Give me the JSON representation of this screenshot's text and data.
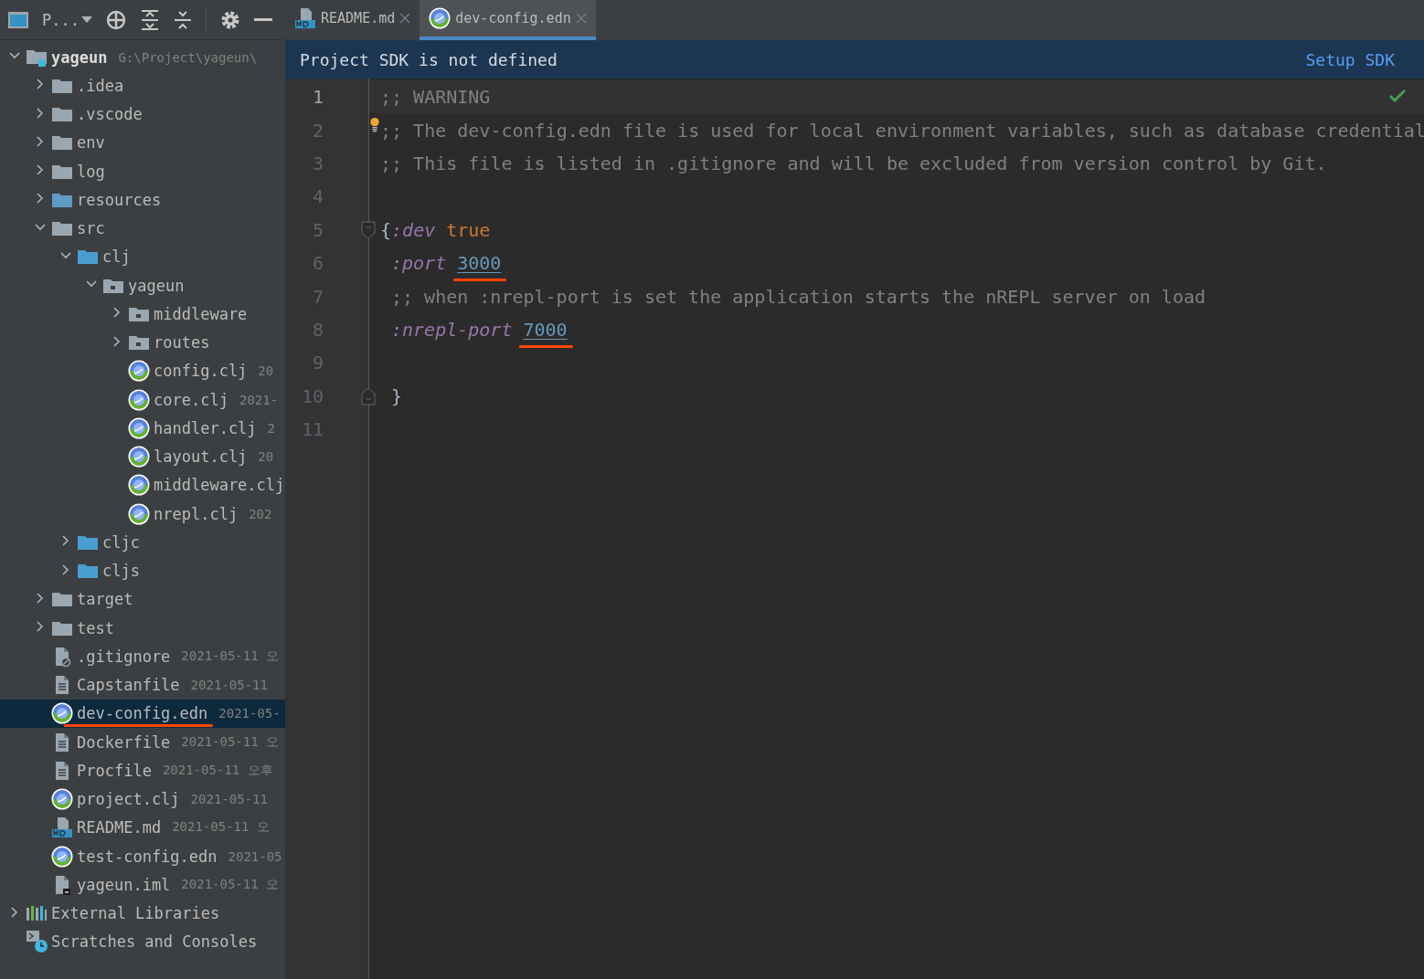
{
  "project_panel": {
    "title": "P...",
    "tree": [
      {
        "name": "yageun",
        "kind": "module",
        "expanded": true,
        "path": "G:\\Project\\yageun\\",
        "selected": false,
        "children": [
          {
            "name": ".idea",
            "kind": "folder",
            "expanded": false,
            "selected": false
          },
          {
            "name": ".vscode",
            "kind": "folder",
            "expanded": false,
            "selected": false
          },
          {
            "name": "env",
            "kind": "folder",
            "expanded": false,
            "selected": false
          },
          {
            "name": "log",
            "kind": "folder",
            "expanded": false,
            "selected": false
          },
          {
            "name": "resources",
            "kind": "resource-folder",
            "expanded": false,
            "selected": false
          },
          {
            "name": "src",
            "kind": "folder",
            "expanded": true,
            "selected": false,
            "children": [
              {
                "name": "clj",
                "kind": "source-folder",
                "expanded": true,
                "selected": false,
                "children": [
                  {
                    "name": "yageun",
                    "kind": "package",
                    "expanded": true,
                    "selected": false,
                    "children": [
                      {
                        "name": "middleware",
                        "kind": "package",
                        "expanded": false,
                        "selected": false
                      },
                      {
                        "name": "routes",
                        "kind": "package",
                        "expanded": false,
                        "selected": false
                      },
                      {
                        "name": "config.clj",
                        "kind": "clojure",
                        "date": "20",
                        "selected": false
                      },
                      {
                        "name": "core.clj",
                        "kind": "clojure",
                        "date": "2021-",
                        "selected": false
                      },
                      {
                        "name": "handler.clj",
                        "kind": "clojure",
                        "date": "2",
                        "selected": false
                      },
                      {
                        "name": "layout.clj",
                        "kind": "clojure",
                        "date": "20",
                        "selected": false
                      },
                      {
                        "name": "middleware.clj",
                        "kind": "clojure",
                        "selected": false
                      },
                      {
                        "name": "nrepl.clj",
                        "kind": "clojure",
                        "date": "202",
                        "selected": false
                      }
                    ]
                  }
                ]
              },
              {
                "name": "cljc",
                "kind": "source-folder",
                "expanded": false,
                "selected": false
              },
              {
                "name": "cljs",
                "kind": "source-folder",
                "expanded": false,
                "selected": false
              }
            ]
          },
          {
            "name": "target",
            "kind": "folder",
            "expanded": false,
            "selected": false
          },
          {
            "name": "test",
            "kind": "folder",
            "expanded": false,
            "selected": false
          },
          {
            "name": ".gitignore",
            "kind": "ignored",
            "date": "2021-05-11 오",
            "selected": false
          },
          {
            "name": "Capstanfile",
            "kind": "text",
            "date": "2021-05-11",
            "selected": false
          },
          {
            "name": "dev-config.edn",
            "kind": "clojure",
            "date": "2021-05-",
            "selected": true,
            "annotated": true
          },
          {
            "name": "Dockerfile",
            "kind": "text",
            "date": "2021-05-11 오",
            "selected": false
          },
          {
            "name": "Procfile",
            "kind": "text",
            "date": "2021-05-11 오후",
            "selected": false
          },
          {
            "name": "project.clj",
            "kind": "clojure",
            "date": "2021-05-11",
            "selected": false
          },
          {
            "name": "README.md",
            "kind": "markdown",
            "date": "2021-05-11 오",
            "selected": false
          },
          {
            "name": "test-config.edn",
            "kind": "clojure",
            "date": "2021-05",
            "selected": false
          },
          {
            "name": "yageun.iml",
            "kind": "iml",
            "date": "2021-05-11 오",
            "selected": false
          }
        ]
      },
      {
        "name": "External Libraries",
        "kind": "libraries",
        "expanded": false,
        "selected": false
      },
      {
        "name": "Scratches and Consoles",
        "kind": "scratches",
        "selected": false
      }
    ]
  },
  "tabs": [
    {
      "label": "README.md",
      "kind": "markdown",
      "selected": false
    },
    {
      "label": "dev-config.edn",
      "kind": "clojure",
      "selected": true
    }
  ],
  "banner": {
    "message": "Project SDK is not defined",
    "action": "Setup SDK"
  },
  "editor": {
    "lines": [
      {
        "number": "1",
        "current": true,
        "tokens": [
          {
            "kind": "comment",
            "text": ";; WARNING"
          }
        ]
      },
      {
        "number": "2",
        "intention": true,
        "tokens": [
          {
            "kind": "comment",
            "text": ";; The dev-config.edn file is used for local environment variables, such as database credential"
          }
        ]
      },
      {
        "number": "3",
        "tokens": [
          {
            "kind": "comment",
            "text": ";; This file is listed in .gitignore and will be excluded from version control by Git."
          }
        ]
      },
      {
        "number": "4"
      },
      {
        "number": "5",
        "fold_start": true,
        "tokens": [
          {
            "kind": "plain",
            "text": "{"
          },
          {
            "kind": "keyword",
            "text": ":dev"
          },
          {
            "kind": "constant",
            "text": "true"
          }
        ]
      },
      {
        "number": "6",
        "indent": true,
        "tokens": [
          {
            "kind": "keyword",
            "text": ":port"
          },
          {
            "kind": "number",
            "text": "3000",
            "annotated": true
          }
        ]
      },
      {
        "number": "7",
        "indent": true,
        "tokens": [
          {
            "kind": "comment",
            "text": ";; when :nrepl-port is set the application starts the nREPL server on load"
          }
        ]
      },
      {
        "number": "8",
        "indent": true,
        "tokens": [
          {
            "kind": "keyword",
            "text": ":nrepl-port"
          },
          {
            "kind": "number",
            "text": "7000",
            "annotated": true
          }
        ]
      },
      {
        "number": "9"
      },
      {
        "number": "10",
        "fold_end": true,
        "indent": true,
        "tokens": [
          {
            "kind": "plain",
            "text": "}"
          }
        ]
      },
      {
        "number": "11"
      }
    ]
  }
}
